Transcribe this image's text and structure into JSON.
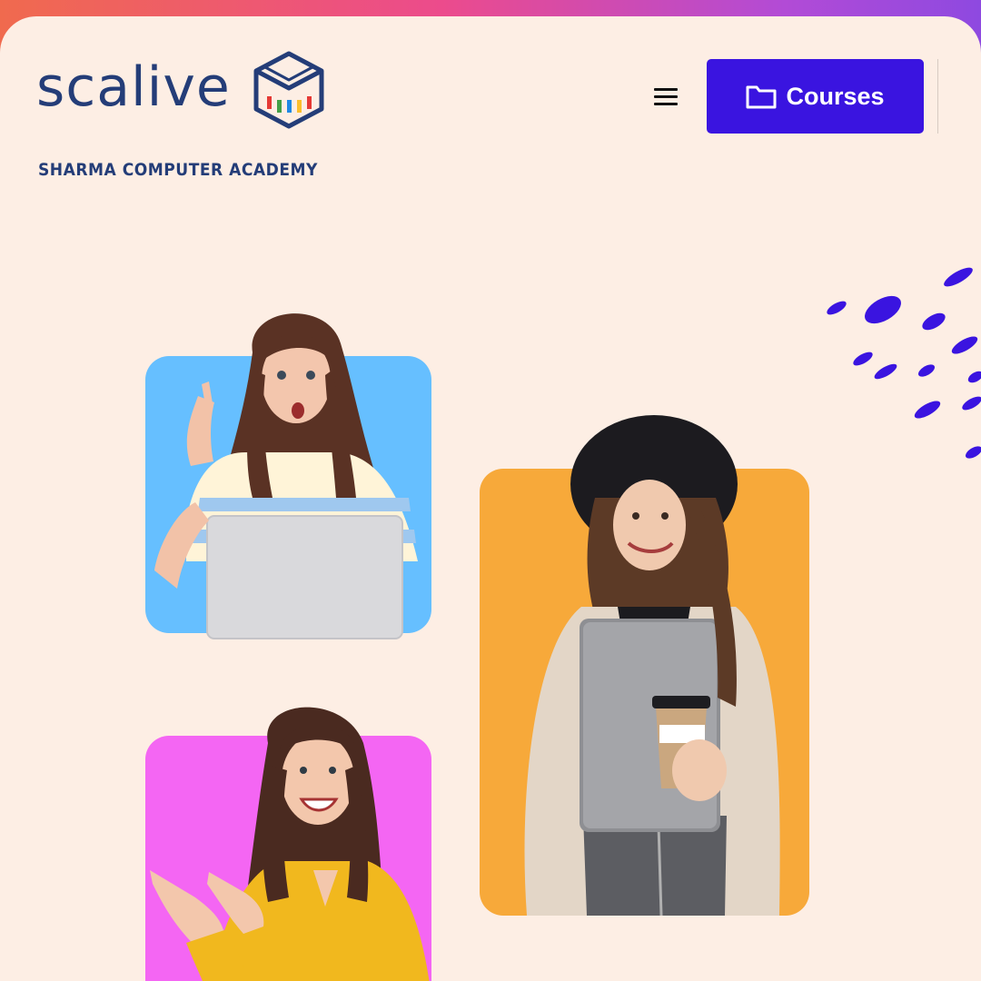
{
  "brand": {
    "wordmark": "scalive",
    "subtitle": "SHARMA COMPUTER ACADEMY",
    "text_color": "#243d78",
    "cube_colors": [
      "#e53935",
      "#43a047",
      "#1e88e5",
      "#fbc02d"
    ]
  },
  "header": {
    "menu_icon": "hamburger-menu-icon",
    "courses_button": {
      "label": "Courses",
      "icon": "folder-icon",
      "color": "#3a14e0"
    }
  },
  "hero": {
    "card_colors": {
      "blue": "#66bfff",
      "orange": "#f7a93a",
      "pink": "#f466f3"
    },
    "accent_dots_color": "#3a14e0"
  },
  "colors": {
    "page_background": "#fdeee4",
    "top_gradient": [
      "#f06a4e",
      "#ec4b8c",
      "#8e49e0"
    ]
  }
}
